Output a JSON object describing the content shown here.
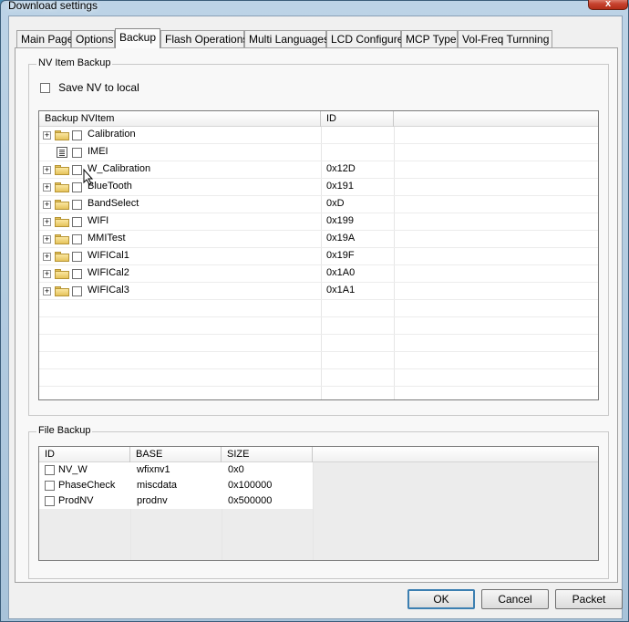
{
  "window": {
    "title": "Download settings",
    "close_label": "x"
  },
  "tabs": [
    {
      "label": "Main Page"
    },
    {
      "label": "Options"
    },
    {
      "label": "Backup"
    },
    {
      "label": "Flash Operations"
    },
    {
      "label": "Multi Languages"
    },
    {
      "label": "LCD Configure"
    },
    {
      "label": "MCP Type"
    },
    {
      "label": "Vol-Freq Turnning"
    }
  ],
  "nv_backup": {
    "group_label": "NV Item Backup",
    "save_nv_label": "Save NV to local",
    "columns": [
      "Backup NVItem",
      "ID"
    ],
    "items": [
      {
        "name": "Calibration",
        "id": "",
        "type": "folder"
      },
      {
        "name": "IMEI",
        "id": "",
        "type": "doc"
      },
      {
        "name": "W_Calibration",
        "id": "0x12D",
        "type": "folder"
      },
      {
        "name": "BlueTooth",
        "id": "0x191",
        "type": "folder"
      },
      {
        "name": "BandSelect",
        "id": "0xD",
        "type": "folder"
      },
      {
        "name": "WIFI",
        "id": "0x199",
        "type": "folder"
      },
      {
        "name": "MMITest",
        "id": "0x19A",
        "type": "folder"
      },
      {
        "name": "WIFICal1",
        "id": "0x19F",
        "type": "folder"
      },
      {
        "name": "WIFICal2",
        "id": "0x1A0",
        "type": "folder"
      },
      {
        "name": "WIFICal3",
        "id": "0x1A1",
        "type": "folder"
      }
    ]
  },
  "file_backup": {
    "group_label": "File Backup",
    "columns": [
      "ID",
      "BASE",
      "SIZE"
    ],
    "rows": [
      {
        "id": "NV_W",
        "base": "wfixnv1",
        "size": "0x0"
      },
      {
        "id": "PhaseCheck",
        "base": "miscdata",
        "size": "0x100000"
      },
      {
        "id": "ProdNV",
        "base": "prodnv",
        "size": "0x500000"
      }
    ]
  },
  "buttons": {
    "ok": "OK",
    "cancel": "Cancel",
    "packet": "Packet"
  }
}
